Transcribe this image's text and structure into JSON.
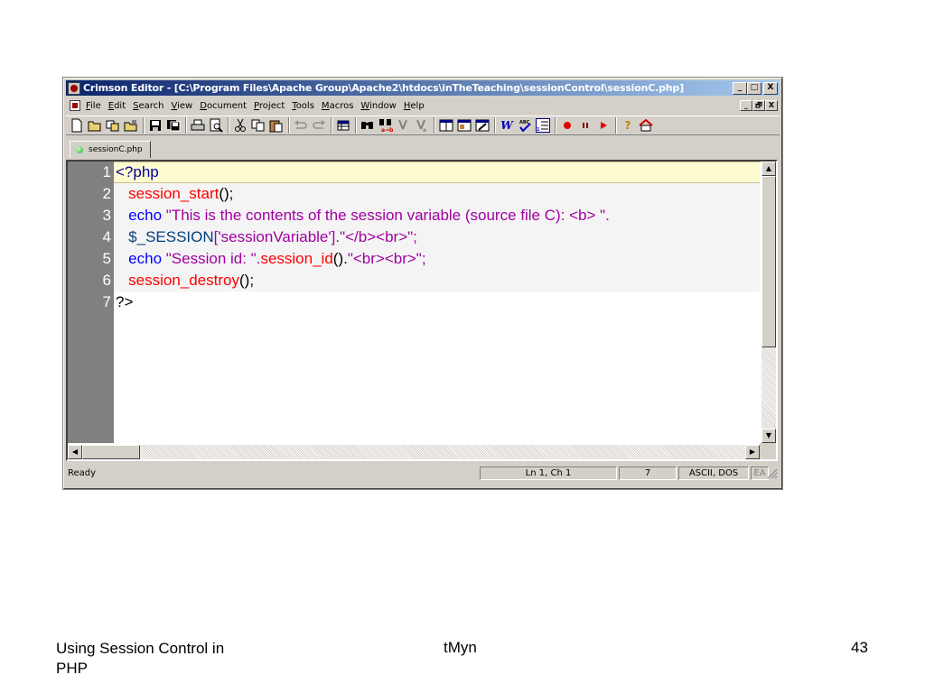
{
  "window": {
    "title": "Crimson Editor - [C:\\Program Files\\Apache Group\\Apache2\\htdocs\\inTheTeaching\\sessionControl\\sessionC.php]",
    "caption_buttons": [
      "_",
      "□",
      "X"
    ],
    "mdi_buttons": [
      "_",
      "🗗",
      "X"
    ]
  },
  "menu": {
    "items": [
      "File",
      "Edit",
      "Search",
      "View",
      "Document",
      "Project",
      "Tools",
      "Macros",
      "Window",
      "Help"
    ]
  },
  "toolbar": {
    "icons": [
      "new-file-icon",
      "open-folder-icon",
      "recent-files-icon",
      "open-remote-icon",
      "save-icon",
      "save-all-icon",
      "print-icon",
      "print-preview-icon",
      "cut-icon",
      "copy-icon",
      "paste-icon",
      "undo-icon",
      "redo-icon",
      "column-mode-icon",
      "find-icon",
      "find-next-icon",
      "replace-icon",
      "goto-icon",
      "tile-icon",
      "directory-tree-icon",
      "output-window-icon",
      "word-wrap-icon",
      "spell-check-icon",
      "line-numbers-icon",
      "record-macro-icon",
      "pause-macro-icon",
      "play-macro-icon",
      "help-icon",
      "home-icon"
    ]
  },
  "tab": {
    "label": "sessionC.php"
  },
  "editor": {
    "line_numbers": [
      "1",
      "2",
      "3",
      "4",
      "5",
      "6",
      "7"
    ],
    "lines": [
      [
        {
          "t": "<?php",
          "c": "php"
        }
      ],
      [
        {
          "t": "   session_start",
          "c": "fn"
        },
        {
          "t": "();",
          "c": "plain"
        }
      ],
      [
        {
          "t": "   echo",
          "c": "kw"
        },
        {
          "t": " \"This is the contents of the session variable (source file C): <b> \".",
          "c": "str"
        }
      ],
      [
        {
          "t": "   $_SESSION",
          "c": "var"
        },
        {
          "t": "['sessionVariable'].\"</b><br>\";",
          "c": "str"
        }
      ],
      [
        {
          "t": "   echo",
          "c": "kw"
        },
        {
          "t": " \"Session id: \".",
          "c": "str"
        },
        {
          "t": "session_id",
          "c": "fn"
        },
        {
          "t": "().",
          "c": "plain"
        },
        {
          "t": "\"<br><br>\";",
          "c": "str"
        }
      ],
      [
        {
          "t": "   session_destroy",
          "c": "fn"
        },
        {
          "t": "();",
          "c": "plain"
        }
      ],
      [
        {
          "t": "?>",
          "c": "plain"
        }
      ]
    ]
  },
  "status": {
    "ready": "Ready",
    "position": "Ln 1, Ch 1",
    "lines": "7",
    "encoding": "ASCII, DOS",
    "ea": "EA"
  },
  "footer": {
    "left": "Using Session Control in\nPHP",
    "center": "tMyn",
    "right": "43"
  }
}
